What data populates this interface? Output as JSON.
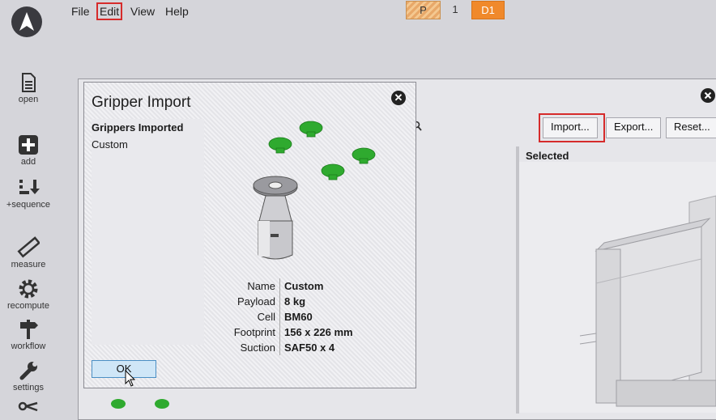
{
  "menu": [
    "File",
    "Edit",
    "View",
    "Help"
  ],
  "mode": {
    "p": "P",
    "one": "1",
    "d1": "D1"
  },
  "rail": [
    {
      "id": "open",
      "label": "open",
      "icon": "document-icon"
    },
    {
      "id": "add",
      "label": "add",
      "icon": "plus-square-icon"
    },
    {
      "id": "sequence",
      "label": "+sequence",
      "icon": "sequence-icon"
    },
    {
      "id": "measure",
      "label": "measure",
      "icon": "ruler-icon"
    },
    {
      "id": "recompute",
      "label": "recompute",
      "icon": "gear-icon"
    },
    {
      "id": "workflow",
      "label": "workflow",
      "icon": "signpost-icon"
    },
    {
      "id": "settings",
      "label": "settings",
      "icon": "wrench-icon"
    }
  ],
  "toolbar": {
    "import": "Import...",
    "export": "Export...",
    "reset": "Reset..."
  },
  "panel": {
    "selected_label": "Selected"
  },
  "dialog": {
    "title": "Gripper Import",
    "list_header": "Grippers Imported",
    "list_items": [
      "Custom"
    ],
    "props": [
      {
        "k": "Name",
        "v": "Custom"
      },
      {
        "k": "Payload",
        "v": "8 kg"
      },
      {
        "k": "Cell",
        "v": "BM60"
      },
      {
        "k": "Footprint",
        "v": "156 x 226 mm"
      },
      {
        "k": "Suction",
        "v": "SAF50 x 4"
      }
    ],
    "ok": "OK"
  },
  "colors": {
    "accent_orange": "#f0892b",
    "suction_green": "#2faa2f",
    "highlight_red": "#d62b2b"
  }
}
